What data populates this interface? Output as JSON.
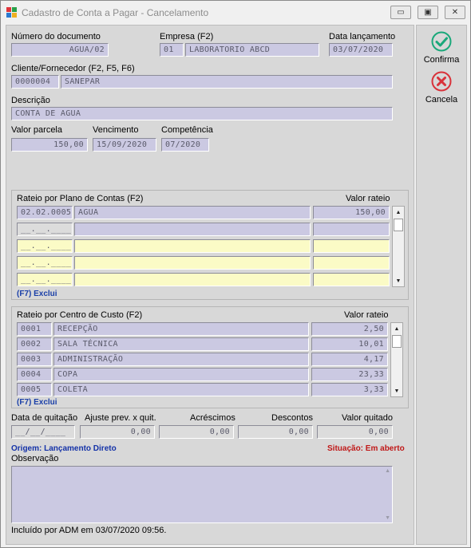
{
  "window": {
    "title": "Cadastro de Conta a Pagar - Cancelamento",
    "minimize_glyph": "▭",
    "maximize_glyph": "▣",
    "close_glyph": "✕"
  },
  "toolbar": {
    "confirm_label": "Confirma",
    "cancel_label": "Cancela",
    "confirm_icon": "check-circle-icon",
    "cancel_icon": "x-circle-icon",
    "confirm_color": "#1aa87a",
    "cancel_color": "#d9323a"
  },
  "header": {
    "doc_number_label": "Número do documento",
    "doc_number_value": "AGUA/02",
    "empresa_label": "Empresa (F2)",
    "empresa_code": "01",
    "empresa_name": "LABORATORIO ABCD",
    "data_lancamento_label": "Data lançamento",
    "data_lancamento_value": "03/07/2020",
    "cliente_label": "Cliente/Fornecedor (F2, F5, F6)",
    "cliente_code": "0000004",
    "cliente_name": "SANEPAR",
    "descricao_label": "Descrição",
    "descricao_value": "CONTA DE AGUA",
    "valor_parcela_label": "Valor parcela",
    "valor_parcela_value": "150,00",
    "vencimento_label": "Vencimento",
    "vencimento_value": "15/09/2020",
    "competencia_label": "Competência",
    "competencia_value": "07/2020"
  },
  "rateio_plano": {
    "title": "Rateio por Plano de Contas (F2)",
    "value_header": "Valor rateio",
    "rows": [
      {
        "code": "02.02.0005",
        "name": "AGUA",
        "value": "150,00"
      },
      {
        "code": "__.__.____",
        "name": "",
        "value": ""
      },
      {
        "code": "__.__.____",
        "name": "",
        "value": ""
      },
      {
        "code": "__.__.____",
        "name": "",
        "value": ""
      },
      {
        "code": "__.__.____",
        "name": "",
        "value": ""
      }
    ],
    "exclui_label": "(F7) Exclui"
  },
  "rateio_centro": {
    "title": "Rateio por Centro de Custo (F2)",
    "value_header": "Valor rateio",
    "rows": [
      {
        "code": "0001",
        "name": "RECEPÇÃO",
        "value": "2,50"
      },
      {
        "code": "0002",
        "name": "SALA TÉCNICA",
        "value": "10,01"
      },
      {
        "code": "0003",
        "name": "ADMINISTRAÇÃO",
        "value": "4,17"
      },
      {
        "code": "0004",
        "name": "COPA",
        "value": "23,33"
      },
      {
        "code": "0005",
        "name": "COLETA",
        "value": "3,33"
      }
    ],
    "exclui_label": "(F7) Exclui"
  },
  "quitacao": {
    "data_label": "Data de quitação",
    "data_value": "__/__/____",
    "ajuste_label": "Ajuste prev. x quit.",
    "ajuste_value": "0,00",
    "acrescimos_label": "Acréscimos",
    "acrescimos_value": "0,00",
    "descontos_label": "Descontos",
    "descontos_value": "0,00",
    "valor_quitado_label": "Valor quitado",
    "valor_quitado_value": "0,00"
  },
  "status": {
    "origem": "Origem: Lançamento Direto",
    "situacao": "Situação: Em aberto",
    "observacao_label": "Observação",
    "observacao_value": "",
    "footer": "Incluído por ADM em 03/07/2020 09:56."
  }
}
